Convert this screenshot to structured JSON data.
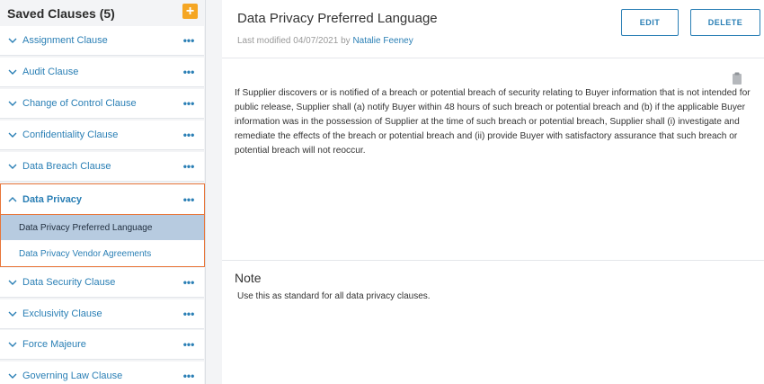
{
  "sidebar": {
    "title": "Saved Clauses (5)",
    "add_icon": "plus-icon",
    "clauses_top": [
      {
        "label": "Assignment Clause",
        "menu": "•••"
      },
      {
        "label": "Audit Clause",
        "menu": "•••"
      },
      {
        "label": "Change of Control Clause",
        "menu": "•••"
      },
      {
        "label": "Confidentiality Clause",
        "menu": "•••"
      },
      {
        "label": "Data Breach Clause",
        "menu": "•••"
      }
    ],
    "expanded_group": {
      "label": "Data Privacy",
      "menu": "•••",
      "items": [
        {
          "label": "Data Privacy Preferred Language",
          "selected": true
        },
        {
          "label": "Data Privacy Vendor Agreements",
          "selected": false
        }
      ]
    },
    "clauses_bottom": [
      {
        "label": "Data Security Clause",
        "menu": "•••"
      },
      {
        "label": "Exclusivity Clause",
        "menu": "•••"
      },
      {
        "label": "Force Majeure",
        "menu": "•••"
      },
      {
        "label": "Governing Law Clause",
        "menu": "•••"
      }
    ]
  },
  "main": {
    "title": "Data Privacy Preferred Language",
    "meta_prefix": "Last modified 04/07/2021 by",
    "author": "Natalie Feeney",
    "edit_label": "EDIT",
    "delete_label": "DELETE",
    "clause_text": "If Supplier discovers or is notified of a breach or potential breach of security relating to Buyer information that is not intended for public release, Supplier shall (a) notify Buyer within 48 hours of such breach or potential breach and (b) if the applicable Buyer information was in the possession of Supplier at the time of such breach or potential breach, Supplier shall (i) investigate and remediate the effects of the breach or potential breach and (ii) provide Buyer with satisfactory assurance that such breach or potential breach will not reoccur.",
    "note_title": "Note",
    "note_text": "Use this as standard for all data privacy clauses."
  },
  "colors": {
    "accent": "#2a7fb5",
    "add_button": "#f5a623",
    "selected_group_border": "#e8763a",
    "selected_item_bg": "#b7cbe0"
  }
}
